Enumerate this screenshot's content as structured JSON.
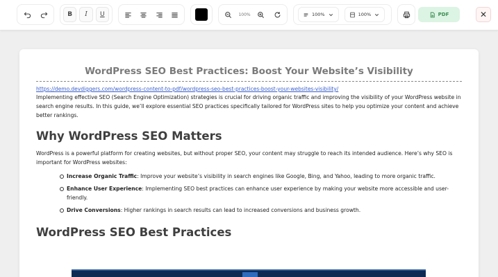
{
  "toolbar": {
    "zoom_value": "100%",
    "line_spacing": "100%",
    "page_scale": "100%",
    "pdf_label": "PDF",
    "text_color": "#000000",
    "icons": [
      "undo-icon",
      "redo-icon",
      "bold",
      "italic",
      "underline",
      "align-left-icon",
      "align-center-icon",
      "align-right-icon",
      "align-justify-icon",
      "zoom-out-icon",
      "zoom-in-icon",
      "reset-icon",
      "line-height-icon",
      "page-icon",
      "print-icon",
      "file-icon",
      "close-icon"
    ]
  },
  "toolbar_text": {
    "bold": "B",
    "italic": "I",
    "underline": "U",
    "close": "✕"
  },
  "document": {
    "title": "WordPress SEO Best Practices: Boost Your Website’s Visibility",
    "url": "https://demo.devdiggers.com/wordpress-content-to-pdf/wordpress-seo-best-practices-boost-your-websites-visibility/",
    "intro": "Implementing effective SEO (Search Engine Optimization) strategies is crucial for driving organic traffic and improving the visibility of your WordPress website in search engine results. In this guide, we’ll explore essential SEO practices specifically tailored for WordPress sites to help you optimize your content and achieve better rankings.",
    "section1": {
      "heading": "Why WordPress SEO Matters",
      "body": "WordPress is a powerful platform for creating websites, but without proper SEO, your content may struggle to reach its intended audience. Here’s why SEO is important for WordPress websites:",
      "bullets": [
        {
          "term": "Increase Organic Traffic",
          "text": ": Improve your website’s visibility in search engines like Google, Bing, and Yahoo, leading to more organic traffic."
        },
        {
          "term": "Enhance User Experience",
          "text": ": Implementing SEO best practices can enhance user experience by making your website more accessible and user-friendly."
        },
        {
          "term": "Drive Conversions",
          "text": ": Higher rankings in search results can lead to increased conversions and business growth."
        }
      ]
    },
    "section2": {
      "heading": "WordPress SEO Best Practices"
    }
  }
}
